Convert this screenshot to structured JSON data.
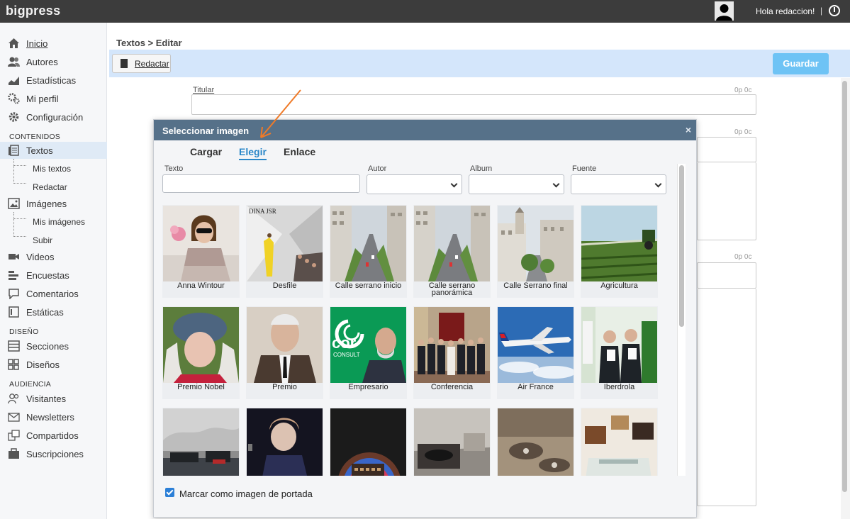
{
  "app": {
    "brand": "bigpress",
    "greeting": "Hola redaccion!",
    "separator": "|"
  },
  "sidebar": {
    "items": [
      {
        "label": "Inicio",
        "icon": "home-icon"
      },
      {
        "label": "Autores",
        "icon": "users-icon"
      },
      {
        "label": "Estadísticas",
        "icon": "stats-icon"
      },
      {
        "label": "Mi perfil",
        "icon": "profile-icon"
      },
      {
        "label": "Configuración",
        "icon": "gear-icon"
      }
    ],
    "sections": {
      "contenidos": "CONTENIDOS",
      "diseno": "DISEÑO",
      "audiencia": "AUDIENCIA"
    },
    "contenidos": {
      "textos": "Textos",
      "mis_textos": "Mis textos",
      "redactar": "Redactar",
      "imagenes": "Imágenes",
      "mis_imagenes": "Mis imágenes",
      "subir": "Subir",
      "videos": "Videos",
      "encuestas": "Encuestas",
      "comentarios": "Comentarios",
      "estaticas": "Estáticas"
    },
    "diseno": {
      "secciones": "Secciones",
      "disenos": "Diseños"
    },
    "audiencia": {
      "visitantes": "Visitantes",
      "newsletters": "Newsletters",
      "compartidos": "Compartidos",
      "suscripciones": "Suscripciones"
    }
  },
  "main": {
    "breadcrumb": "Textos > Editar",
    "toolbar": {
      "redactar": "Redactar",
      "guardar": "Guardar"
    },
    "titular_label": "Titular",
    "counter": "0p 0c"
  },
  "modal": {
    "title": "Seleccionar imagen",
    "close": "×",
    "tabs": [
      "Cargar",
      "Elegir",
      "Enlace"
    ],
    "active_tab": "Elegir",
    "filters": {
      "texto": "Texto",
      "autor": "Autor",
      "album": "Album",
      "fuente": "Fuente"
    },
    "images": [
      {
        "caption": "Anna Wintour",
        "kind": "portrait-woman"
      },
      {
        "caption": "Desfile",
        "kind": "runway"
      },
      {
        "caption": "Calle serrano inicio",
        "kind": "street"
      },
      {
        "caption": "Calle serrano panorámica",
        "kind": "street"
      },
      {
        "caption": "Calle Serrano final",
        "kind": "street2"
      },
      {
        "caption": "Agricultura",
        "kind": "field"
      },
      {
        "caption": "Premio Nobel",
        "kind": "portrait-hat"
      },
      {
        "caption": "Premio",
        "kind": "portrait-old"
      },
      {
        "caption": "Empresario",
        "kind": "business"
      },
      {
        "caption": "Conferencia",
        "kind": "group"
      },
      {
        "caption": "Air France",
        "kind": "plane"
      },
      {
        "caption": "Iberdrola",
        "kind": "group2"
      },
      {
        "caption": "",
        "kind": "harbor"
      },
      {
        "caption": "",
        "kind": "singer"
      },
      {
        "caption": "",
        "kind": "jukebox"
      },
      {
        "caption": "",
        "kind": "turntable"
      },
      {
        "caption": "",
        "kind": "machines"
      },
      {
        "caption": "",
        "kind": "gallery"
      }
    ],
    "checkbox_label": "Marcar como imagen de portada",
    "checkbox_checked": true
  },
  "colors": {
    "accent": "#2a87c8",
    "modal_header": "#567189",
    "save_button": "#6ec3f5"
  }
}
